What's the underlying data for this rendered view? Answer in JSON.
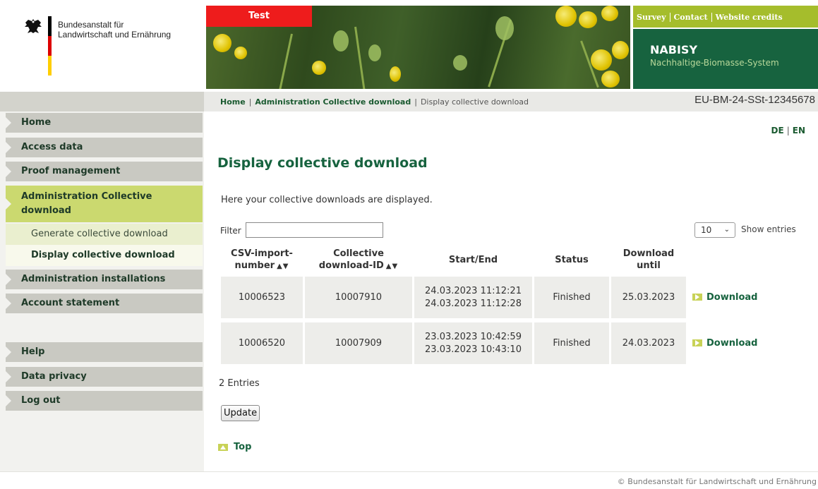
{
  "logo": {
    "line1": "Bundesanstalt für",
    "line2": "Landwirtschaft und Ernährung"
  },
  "banner": {
    "test_tag": "Test"
  },
  "toplinks": {
    "survey": "Survey",
    "contact": "Contact",
    "credits": "Website credits"
  },
  "system": {
    "title": "NABISY",
    "subtitle": "Nachhaltige-Biomasse-System"
  },
  "breadcrumb": {
    "home": "Home",
    "sep1": "|",
    "admin": "Administration Collective download",
    "sep2": "|",
    "current": "Display collective download"
  },
  "account_id": "EU-BM-24-SSt-12345678",
  "sidebar": {
    "items": [
      {
        "label": "Home"
      },
      {
        "label": "Access data"
      },
      {
        "label": "Proof management"
      },
      {
        "label": "Administration Collective download"
      },
      {
        "label": "Administration installations"
      },
      {
        "label": "Account statement"
      },
      {
        "label": "Help"
      },
      {
        "label": "Data privacy"
      },
      {
        "label": "Log out"
      }
    ],
    "subitems": [
      {
        "label": "Generate collective download"
      },
      {
        "label": "Display collective download"
      }
    ]
  },
  "lang": {
    "de": "DE",
    "sep": "|",
    "en": "EN"
  },
  "main": {
    "title": "Display collective download",
    "intro": "Here your collective downloads are displayed.",
    "filter_label": "Filter",
    "filter_value": "",
    "entries_value": "10",
    "entries_label": "Show entries",
    "sort_glyph": "▲▼",
    "columns": {
      "csv_line1": "CSV-import-",
      "csv_line2": "number",
      "dlid_line1": "Collective",
      "dlid_line2": "download-ID",
      "startend": "Start/End",
      "status": "Status",
      "until_line1": "Download",
      "until_line2": "until"
    },
    "rows": [
      {
        "csv": "10006523",
        "dlid": "10007910",
        "start": "24.03.2023 11:12:21",
        "end": "24.03.2023 11:12:28",
        "status": "Finished",
        "until": "25.03.2023",
        "action": "Download"
      },
      {
        "csv": "10006520",
        "dlid": "10007909",
        "start": "23.03.2023 10:42:59",
        "end": "23.03.2023 10:43:10",
        "status": "Finished",
        "until": "24.03.2023",
        "action": "Download"
      }
    ],
    "entry_count": "2 Entries",
    "update_button": "Update",
    "top_link": "Top"
  },
  "footer": {
    "copyright": "© Bundesanstalt für Landwirtschaft und Ernährung"
  }
}
